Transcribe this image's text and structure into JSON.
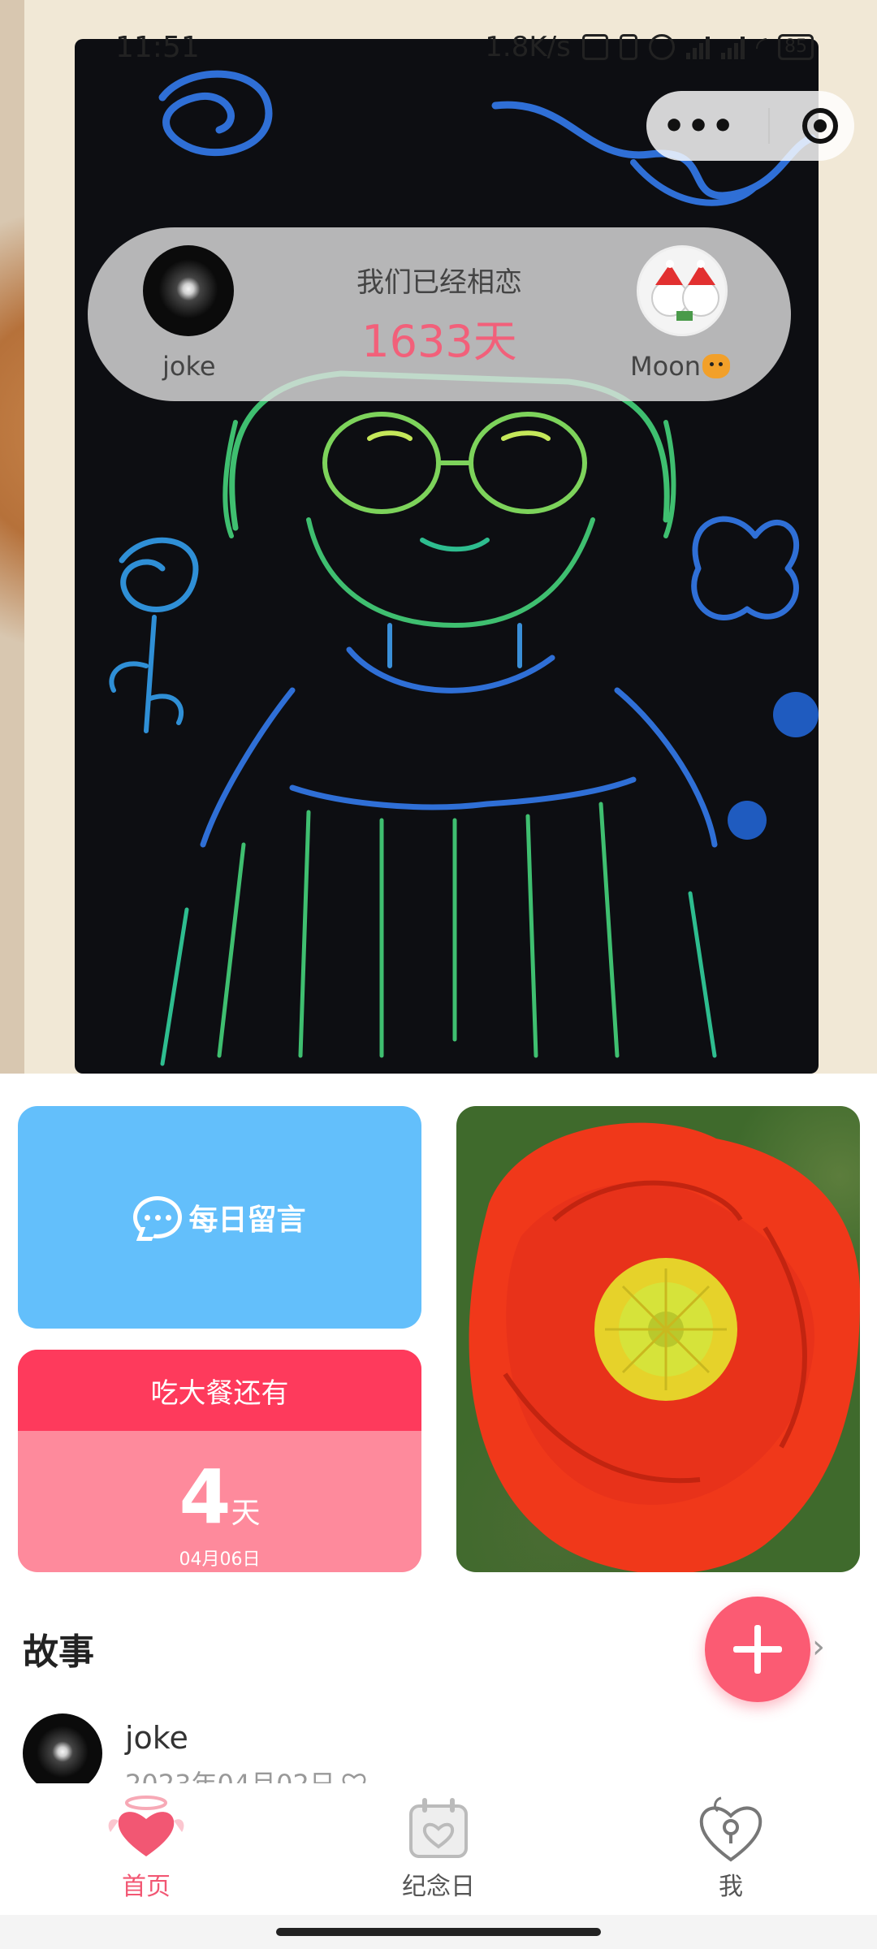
{
  "status_bar": {
    "time": "11:51",
    "net_speed": "1.8K/s",
    "battery": "85"
  },
  "love_card": {
    "title": "我们已经相恋",
    "days": "1633天",
    "left_name": "joke",
    "right_name": "Moon"
  },
  "tiles": {
    "daily_message_label": "每日留言",
    "countdown_title": "吃大餐还有",
    "countdown_number": "4",
    "countdown_unit": "天",
    "countdown_date": "04月06日"
  },
  "stories": {
    "section_title": "故事",
    "chevron": "›",
    "items": [
      {
        "author": "joke",
        "date": "2023年04月02日"
      }
    ]
  },
  "tabbar": {
    "home": "首页",
    "anniversary": "纪念日",
    "me": "我"
  },
  "colors": {
    "accent_pink": "#f25773",
    "fab": "#fb5b73",
    "message_tile": "#63bffb",
    "countdown_head": "#fe3a5c",
    "countdown_body": "#fe8a9c"
  }
}
